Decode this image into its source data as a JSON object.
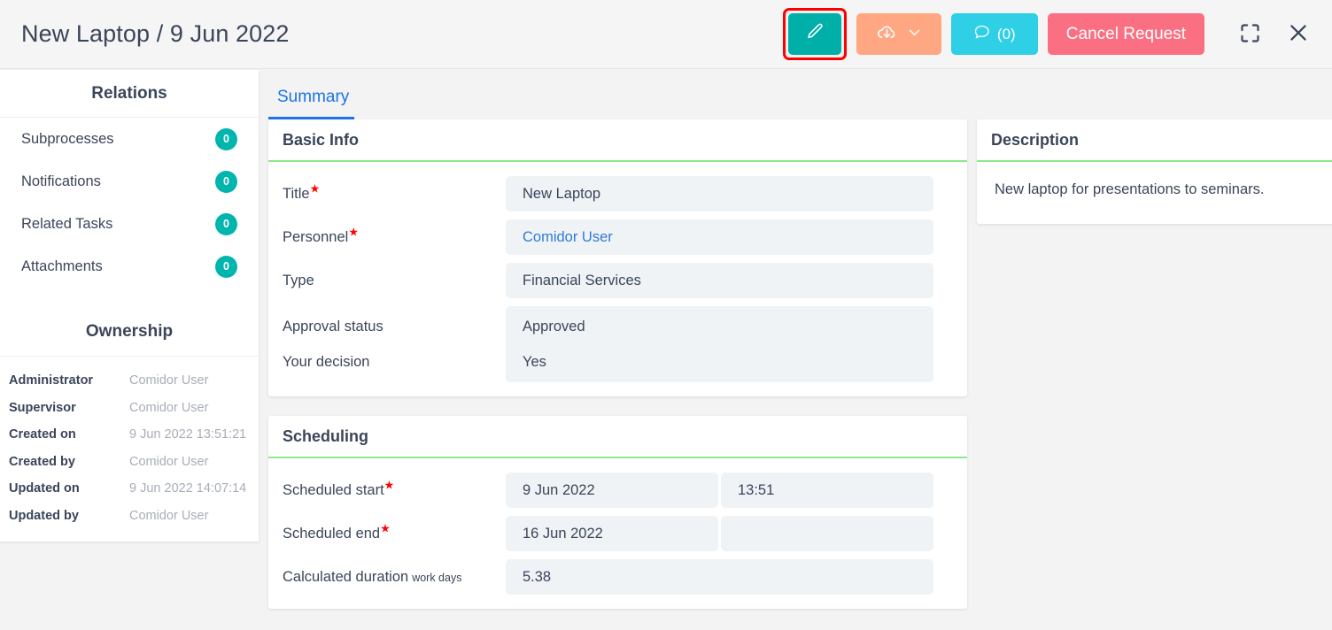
{
  "header": {
    "title": "New Laptop / 9 Jun 2022",
    "actions": {
      "edit": {
        "icon": "pencil-icon",
        "label": ""
      },
      "download": {
        "icon": "cloud-download-icon",
        "chevron": "chevron-down-icon"
      },
      "comments": {
        "icon": "comment-icon",
        "label": "(0)"
      },
      "cancel": {
        "label": "Cancel Request"
      },
      "fullscreen": {
        "icon": "fullscreen-icon"
      },
      "close": {
        "icon": "close-icon"
      }
    },
    "colors": {
      "edit": "#00b0a8",
      "edit_highlight": "#ff0000",
      "download": "#ffa782",
      "comments": "#2fd0e6",
      "cancel": "#fa7082"
    }
  },
  "sidebar": {
    "relations_title": "Relations",
    "relations": [
      {
        "label": "Subprocesses",
        "count": "0"
      },
      {
        "label": "Notifications",
        "count": "0"
      },
      {
        "label": "Related Tasks",
        "count": "0"
      },
      {
        "label": "Attachments",
        "count": "0"
      }
    ],
    "ownership_title": "Ownership",
    "ownership": [
      {
        "key": "Administrator",
        "value": "Comidor User"
      },
      {
        "key": "Supervisor",
        "value": "Comidor User"
      },
      {
        "key": "Created on",
        "value": "9 Jun 2022 13:51:21"
      },
      {
        "key": "Created by",
        "value": "Comidor User"
      },
      {
        "key": "Updated on",
        "value": "9 Jun 2022 14:07:14"
      },
      {
        "key": "Updated by",
        "value": "Comidor User"
      }
    ]
  },
  "main": {
    "tab": "Summary",
    "basic_info": {
      "heading": "Basic Info",
      "title_label": "Title",
      "title_value": "New Laptop",
      "personnel_label": "Personnel",
      "personnel_value": "Comidor User",
      "type_label": "Type",
      "type_value": "Financial Services",
      "approval_label": "Approval status",
      "approval_value": "Approved",
      "decision_label": "Your decision",
      "decision_value": "Yes"
    },
    "scheduling": {
      "heading": "Scheduling",
      "start_label": "Scheduled start",
      "start_date": "9 Jun 2022",
      "start_time": "13:51",
      "end_label": "Scheduled end",
      "end_date": "16 Jun 2022",
      "end_time": "",
      "duration_label": "Calculated duration",
      "duration_unit": "work days",
      "duration_value": "5.38"
    }
  },
  "description": {
    "heading": "Description",
    "text": "New laptop for presentations to seminars."
  }
}
